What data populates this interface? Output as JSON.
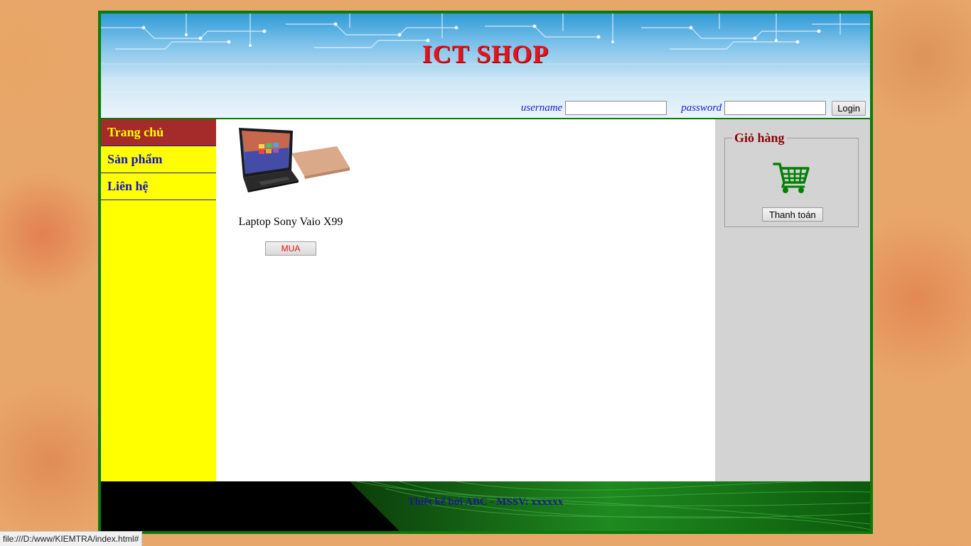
{
  "header": {
    "title": "ICT SHOP",
    "username_label": "username",
    "password_label": "password",
    "login_button": "Login"
  },
  "sidebar": {
    "items": [
      {
        "label": "Trang chủ",
        "active": true
      },
      {
        "label": "Sản phẩm",
        "active": false
      },
      {
        "label": "Liên hệ",
        "active": false
      }
    ]
  },
  "products": [
    {
      "name": "Laptop Sony Vaio X99",
      "buy_label": "MUA",
      "image_icon": "laptop-image"
    }
  ],
  "cart": {
    "title": "Giỏ hàng",
    "icon": "shopping-cart-icon",
    "checkout_label": "Thanh toán"
  },
  "footer": {
    "text": "Thiết kế bởi ABC - MSSV: xxxxxx"
  },
  "status_bar": {
    "url": "file:///D:/www/KIEMTRA/index.html#"
  },
  "colors": {
    "frame_border": "#0a7a0a",
    "title": "#e8121b",
    "sidebar_bg": "#ffff00",
    "active_menu_bg": "#a52a2a",
    "menu_text": "#1414c8",
    "cart_panel_bg": "#d3d3d3",
    "cart_title": "#8b0000",
    "cart_icon": "#008000",
    "buy_text": "#e81010"
  }
}
